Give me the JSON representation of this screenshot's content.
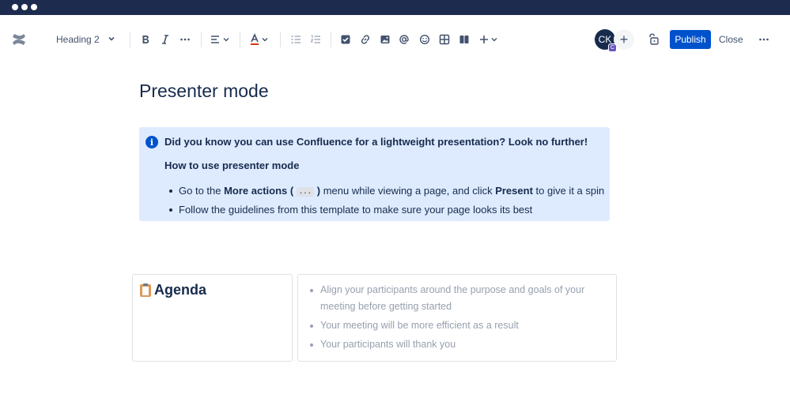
{
  "toolbar": {
    "text_style": "Heading 2",
    "avatar_initials": "CK",
    "avatar_badge": "C",
    "invite_symbol": "+",
    "publish_label": "Publish",
    "close_label": "Close"
  },
  "page": {
    "title": "Presenter mode"
  },
  "info_panel": {
    "icon_glyph": "i",
    "title": "Did you know you can use Confluence for a lightweight presentation? Look no further!",
    "subtitle": "How to use presenter mode",
    "bullet1": {
      "pre": "Go to the ",
      "bold1": "More actions (",
      "code": "...",
      "bold2": ")",
      "mid": " menu while viewing a page, and click ",
      "bold3": "Present",
      "post": " to give it a spin"
    },
    "bullet2": "Follow the guidelines from this template to make sure your page looks its best"
  },
  "agenda": {
    "heading": "Agenda",
    "items": [
      "Align your participants around the purpose and goals of your meeting before getting started",
      "Your meeting will be more efficient as a result",
      "Your participants will thank you"
    ]
  },
  "colors": {
    "titlebar": "#1d2b4f",
    "accent": "#0052cc",
    "info_bg": "#deebff",
    "avatar_badge": "#6554c0"
  },
  "icons": [
    "confluence-logo-icon",
    "chevron-down-icon",
    "bold-icon",
    "italic-icon",
    "more-formatting-icon",
    "align-icon",
    "text-color-icon",
    "bullet-list-icon",
    "numbered-list-icon",
    "task-icon",
    "link-icon",
    "image-icon",
    "mention-icon",
    "emoji-icon",
    "table-icon",
    "layout-icon",
    "insert-plus-icon",
    "unlock-icon",
    "more-icon",
    "info-icon",
    "clipboard-icon"
  ]
}
